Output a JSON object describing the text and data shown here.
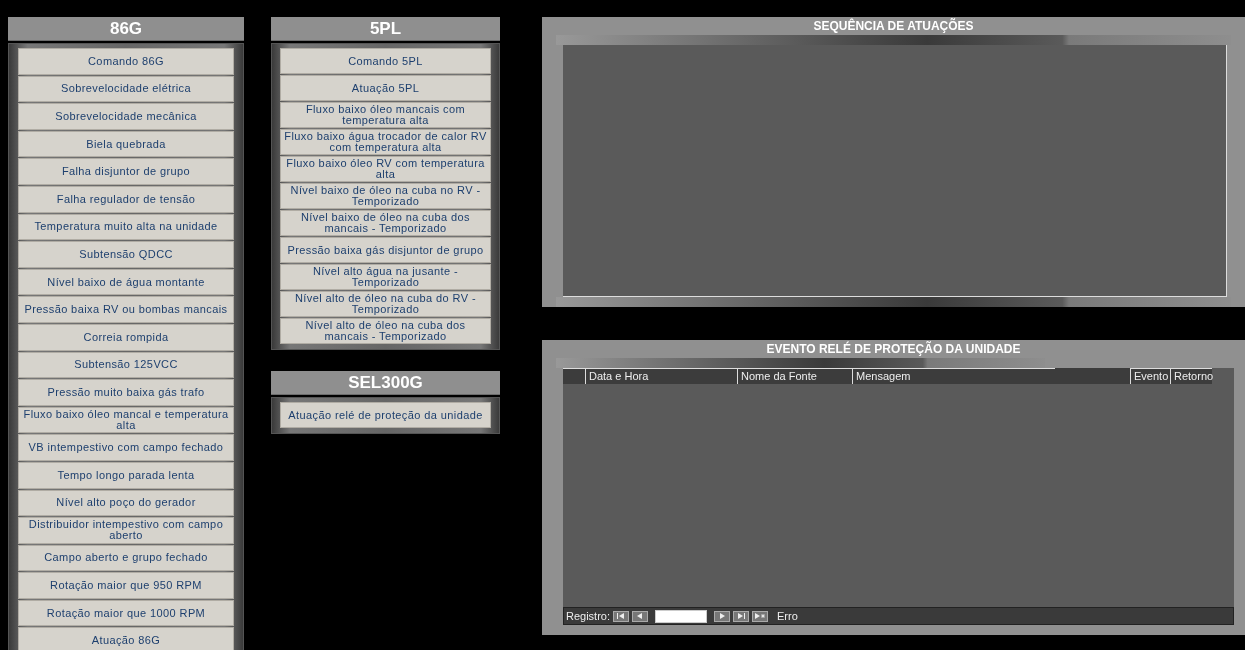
{
  "button_panels": [
    {
      "title": "86G",
      "buttons": [
        "Comando 86G",
        "Sobrevelocidade elétrica",
        "Sobrevelocidade mecânica",
        "Biela quebrada",
        "Falha disjuntor de grupo",
        "Falha regulador de tensão",
        "Temperatura muito alta na unidade",
        "Subtensão QDCC",
        "Nível baixo de água montante",
        "Pressão baixa RV ou bombas mancais",
        "Correia rompida",
        "Subtensão 125VCC",
        "Pressão muito baixa gás trafo",
        "Fluxo baixo óleo mancal e temperatura alta",
        "VB intempestivo com campo fechado",
        "Tempo longo parada lenta",
        "Nível alto poço do gerador",
        "Distribuidor intempestivo com campo aberto",
        "Campo aberto e grupo fechado",
        "Rotação maior que 950 RPM",
        "Rotação maior que 1000 RPM",
        "Atuação 86G"
      ]
    },
    {
      "title": "5PL",
      "buttons": [
        "Comando 5PL",
        "Atuação 5PL",
        "Fluxo baixo óleo mancais com temperatura alta",
        "Fluxo baixo água trocador de calor RV com temperatura alta",
        "Fluxo baixo óleo RV com temperatura alta",
        "Nível baixo de óleo na cuba no RV - Temporizado",
        "Nível baixo de óleo na cuba dos mancais - Temporizado",
        "Pressão baixa gás disjuntor de grupo",
        "Nível alto água na jusante - Temporizado",
        "Nível alto de óleo na cuba do RV - Temporizado",
        "Nível alto de óleo na cuba dos mancais - Temporizado"
      ]
    },
    {
      "title": "SEL300G",
      "buttons": [
        "Atuação relé de proteção da unidade"
      ]
    }
  ],
  "sequence_panel": {
    "title": "SEQUÊNCIA DE ATUAÇÕES"
  },
  "event_panel": {
    "title": "EVENTO RELÉ DE PROTEÇÃO DA UNIDADE",
    "columns": [
      "Data e Hora",
      "Nome da Fonte",
      "Mensagem",
      "Evento",
      "Retorno"
    ],
    "navigator": {
      "label": "Registro:",
      "status": "Erro"
    }
  }
}
